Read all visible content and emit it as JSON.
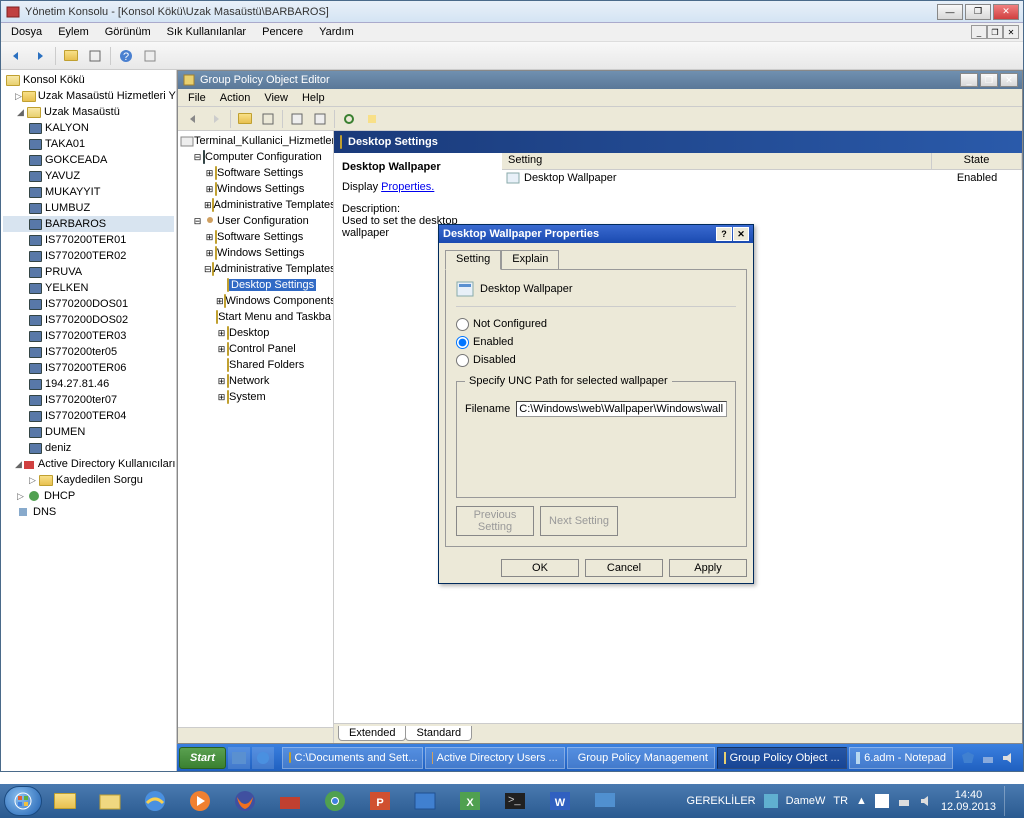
{
  "mmc": {
    "title": "Yönetim Konsolu - [Konsol Kökü\\Uzak Masaüstü\\BARBAROS]",
    "menus": [
      "Dosya",
      "Eylem",
      "Görünüm",
      "Sık Kullanılanlar",
      "Pencere",
      "Yardım"
    ],
    "tree": {
      "root": "Konsol Kökü",
      "n1": "Uzak Masaüstü Hizmetleri Yöne",
      "n2": "Uzak Masaüstü",
      "hosts": [
        "KALYON",
        "TAKA01",
        "GOKCEADA",
        "YAVUZ",
        "MUKAYYIT",
        "LUMBUZ",
        "BARBAROS",
        "IS770200TER01",
        "IS770200TER02",
        "PRUVA",
        "YELKEN",
        "IS770200DOS01",
        "IS770200DOS02",
        "IS770200TER03",
        "IS770200ter05",
        "IS770200TER06",
        "194.27.81.46",
        "IS770200ter07",
        "IS770200TER04",
        "DUMEN",
        "deniz"
      ],
      "ad": "Active Directory Kullanıcıları ve",
      "ad1": "Kaydedilen Sorgu",
      "dhcp": "DHCP",
      "dns": "DNS"
    }
  },
  "gpo": {
    "title": "Group Policy Object Editor",
    "menus": [
      "File",
      "Action",
      "View",
      "Help"
    ],
    "tree": {
      "root": "Terminal_Kullanici_Hizmetleri [pruva",
      "cc": "Computer Configuration",
      "ss": "Software Settings",
      "ws": "Windows Settings",
      "at": "Administrative Templates",
      "uc": "User Configuration",
      "ds": "Desktop Settings",
      "wc": "Windows Components",
      "sm": "Start Menu and Taskba",
      "dk": "Desktop",
      "cp": "Control Panel",
      "sf": "Shared Folders",
      "nw": "Network",
      "sy": "System"
    },
    "detail": {
      "header": "Desktop Settings",
      "h": "Desktop Wallpaper",
      "display": "Display",
      "props": "Properties.",
      "desc": "Description:",
      "descv": "Used to set the desktop wallpaper",
      "col_setting": "Setting",
      "col_state": "State",
      "row_setting": "Desktop Wallpaper",
      "row_state": "Enabled",
      "tab_ext": "Extended",
      "tab_std": "Standard"
    }
  },
  "prop": {
    "title": "Desktop Wallpaper Properties",
    "tab_s": "Setting",
    "tab_e": "Explain",
    "name": "Desktop Wallpaper",
    "nc": "Not Configured",
    "en": "Enabled",
    "di": "Disabled",
    "grp": "Specify UNC Path for selected wallpaper",
    "fn": "Filename",
    "fnv": "C:\\Windows\\web\\Wallpaper\\Windows\\wall",
    "prev": "Previous Setting",
    "next": "Next Setting",
    "ok": "OK",
    "cancel": "Cancel",
    "apply": "Apply"
  },
  "itb": {
    "start": "Start",
    "items": [
      "C:\\Documents and Sett...",
      "Active Directory Users ...",
      "Group Policy Management",
      "Group Policy Object ...",
      "6.adm - Notepad"
    ]
  },
  "otb": {
    "gerek": "GEREKLİLER",
    "dame": "DameW",
    "time": "14:40",
    "date": "12.09.2013"
  }
}
